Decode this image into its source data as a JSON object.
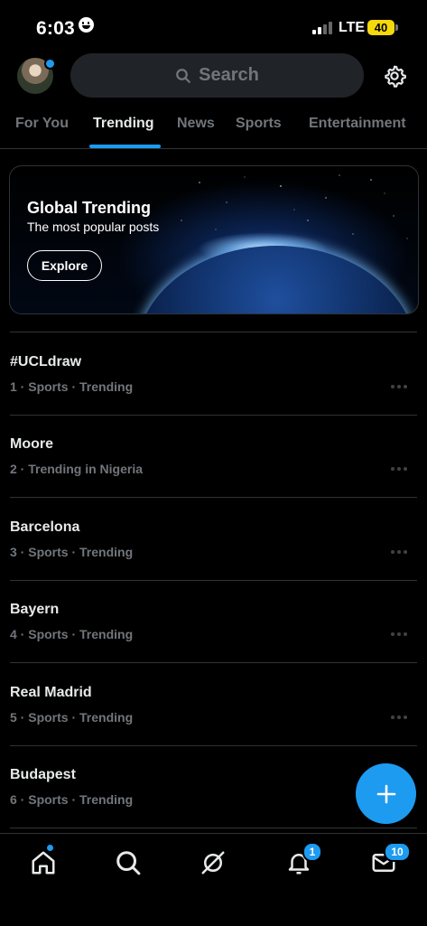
{
  "status_bar": {
    "time": "6:03",
    "network": "LTE",
    "battery": "40"
  },
  "header": {
    "search_label": "Search"
  },
  "tabs": [
    {
      "label": "For You"
    },
    {
      "label": "Trending"
    },
    {
      "label": "News"
    },
    {
      "label": "Sports"
    },
    {
      "label": "Entertainment"
    }
  ],
  "active_tab": "Trending",
  "banner": {
    "title": "Global Trending",
    "subtitle": "The most popular posts",
    "button_label": "Explore"
  },
  "trends": [
    {
      "title": "#UCLdraw",
      "meta": "1 · Sports · Trending"
    },
    {
      "title": "Moore",
      "meta": "2 · Trending in Nigeria"
    },
    {
      "title": "Barcelona",
      "meta": "3 · Sports · Trending"
    },
    {
      "title": "Bayern",
      "meta": "4 · Sports · Trending"
    },
    {
      "title": "Real Madrid",
      "meta": "5 · Sports · Trending"
    },
    {
      "title": "Budapest",
      "meta": "6 · Sports · Trending"
    }
  ],
  "bottom_nav": {
    "notifications_badge": "1",
    "messages_badge": "10"
  },
  "colors": {
    "accent": "#1d9bf0",
    "background": "#000000",
    "secondary_text": "#71767b",
    "battery": "#f5d90a"
  },
  "icons": [
    "search-icon",
    "settings-gear-icon",
    "more-options-icon",
    "compose-plus-icon",
    "home-icon",
    "explore-search-icon",
    "grok-icon",
    "notifications-bell-icon",
    "messages-envelope-icon"
  ]
}
